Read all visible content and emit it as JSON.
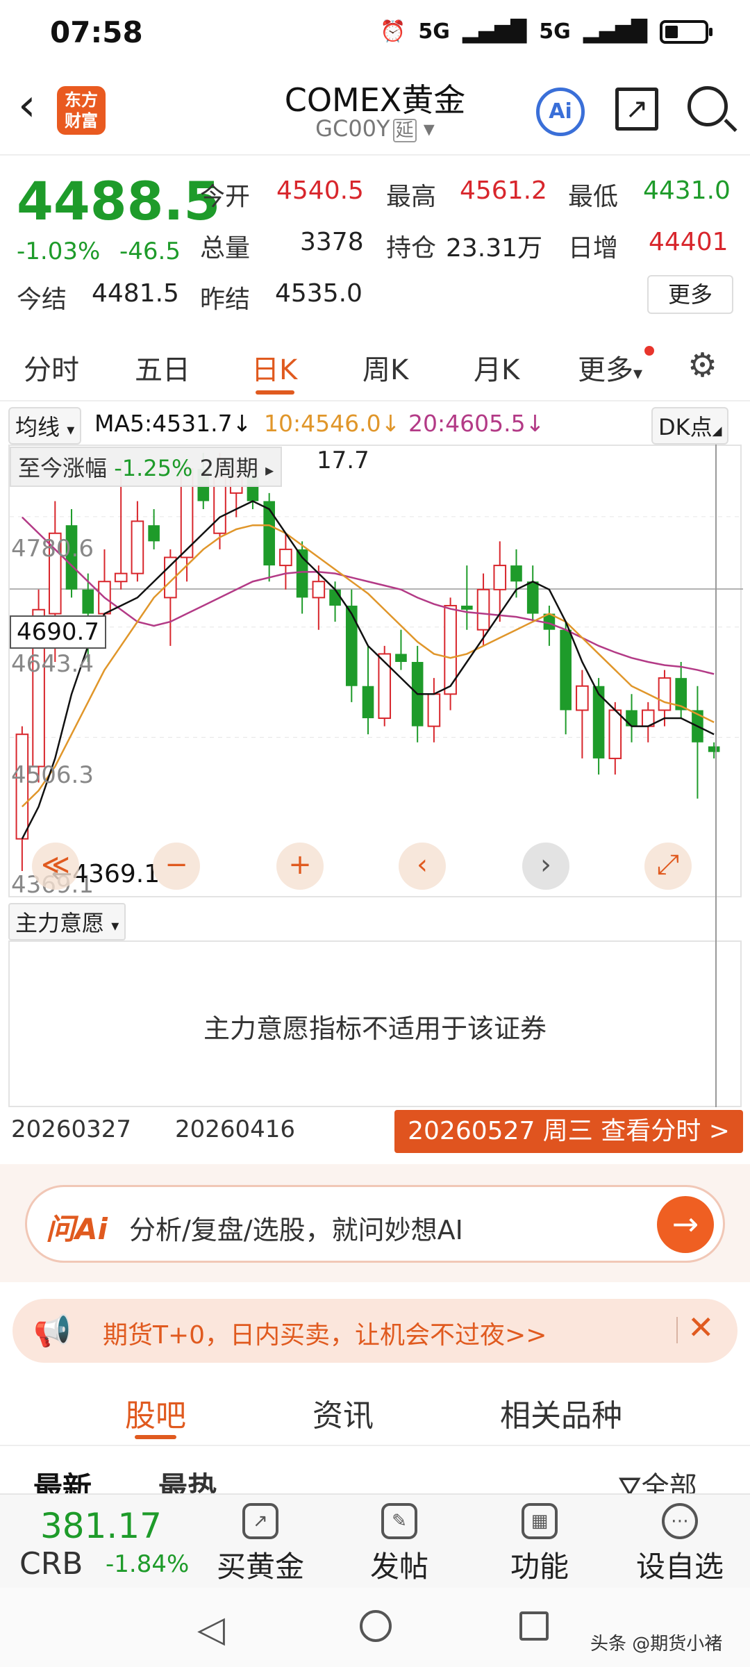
{
  "status": {
    "time": "07:58",
    "net1": "5G",
    "net2": "5G"
  },
  "header": {
    "title": "COMEX黄金",
    "subtitle": "GC00Y",
    "delay_tag": "延",
    "brand": "东方财富",
    "ai_label": "Ai"
  },
  "quote": {
    "price": "4488.5",
    "pct": "-1.03%",
    "change": "-46.5",
    "open_label": "今开",
    "open": "4540.5",
    "high_label": "最高",
    "high": "4561.2",
    "low_label": "最低",
    "low": "4431.0",
    "volume_label": "总量",
    "volume": "3378",
    "oi_label": "持仓",
    "oi": "23.31万",
    "daily_inc_label": "日增",
    "daily_inc": "44401",
    "settle_label": "今结",
    "settle": "4481.5",
    "prev_settle_label": "昨结",
    "prev_settle": "4535.0",
    "more_button": "更多"
  },
  "period_tabs": [
    "分时",
    "五日",
    "日K",
    "周K",
    "月K",
    "更多"
  ],
  "ma_bar": {
    "indicator": "均线",
    "ma5": "MA5:4531.7↓",
    "ma10": "10:4546.0↓",
    "ma20": "20:4605.5↓",
    "dk": "DK点",
    "colors": {
      "ma5": "#111111",
      "ma10": "#e0962a",
      "ma20": "#b33a86"
    }
  },
  "chart": {
    "range_label": "至今涨幅",
    "range_pct": "-1.25%",
    "range_period": "2周期",
    "top_value": "17.7",
    "price_labels": [
      "4780.6",
      "4643.4",
      "4506.3",
      "4369.1"
    ],
    "crosshair": "4690.7",
    "min_marker": "4369.1",
    "nav_buttons": [
      "≪",
      "−",
      "+",
      "‹",
      "›",
      "⤢"
    ]
  },
  "chart_data": {
    "type": "candlestick",
    "ylim": [
      4340,
      4860
    ],
    "up_color": "#d8262c",
    "down_color": "#1e9b2a",
    "candles": [
      {
        "o": 4380,
        "h": 4520,
        "l": 4340,
        "c": 4510
      },
      {
        "o": 4470,
        "h": 4690,
        "l": 4450,
        "c": 4665
      },
      {
        "o": 4660,
        "h": 4800,
        "l": 4600,
        "c": 4760
      },
      {
        "o": 4770,
        "h": 4790,
        "l": 4680,
        "c": 4690
      },
      {
        "o": 4690,
        "h": 4710,
        "l": 4600,
        "c": 4660
      },
      {
        "o": 4660,
        "h": 4740,
        "l": 4640,
        "c": 4700
      },
      {
        "o": 4700,
        "h": 4850,
        "l": 4690,
        "c": 4710
      },
      {
        "o": 4710,
        "h": 4800,
        "l": 4700,
        "c": 4775
      },
      {
        "o": 4770,
        "h": 4790,
        "l": 4740,
        "c": 4750
      },
      {
        "o": 4680,
        "h": 4740,
        "l": 4620,
        "c": 4730
      },
      {
        "o": 4730,
        "h": 4850,
        "l": 4700,
        "c": 4840
      },
      {
        "o": 4840,
        "h": 4860,
        "l": 4790,
        "c": 4800
      },
      {
        "o": 4760,
        "h": 4860,
        "l": 4740,
        "c": 4830
      },
      {
        "o": 4810,
        "h": 4850,
        "l": 4780,
        "c": 4830
      },
      {
        "o": 4830,
        "h": 4840,
        "l": 4790,
        "c": 4800
      },
      {
        "o": 4800,
        "h": 4810,
        "l": 4700,
        "c": 4720
      },
      {
        "o": 4720,
        "h": 4760,
        "l": 4690,
        "c": 4740
      },
      {
        "o": 4740,
        "h": 4750,
        "l": 4660,
        "c": 4680
      },
      {
        "o": 4680,
        "h": 4720,
        "l": 4640,
        "c": 4700
      },
      {
        "o": 4690,
        "h": 4700,
        "l": 4650,
        "c": 4670
      },
      {
        "o": 4670,
        "h": 4690,
        "l": 4550,
        "c": 4570
      },
      {
        "o": 4570,
        "h": 4620,
        "l": 4510,
        "c": 4530
      },
      {
        "o": 4530,
        "h": 4620,
        "l": 4520,
        "c": 4610
      },
      {
        "o": 4610,
        "h": 4640,
        "l": 4590,
        "c": 4600
      },
      {
        "o": 4600,
        "h": 4620,
        "l": 4500,
        "c": 4520
      },
      {
        "o": 4520,
        "h": 4580,
        "l": 4500,
        "c": 4560
      },
      {
        "o": 4560,
        "h": 4680,
        "l": 4540,
        "c": 4670
      },
      {
        "o": 4670,
        "h": 4720,
        "l": 4640,
        "c": 4665
      },
      {
        "o": 4640,
        "h": 4710,
        "l": 4620,
        "c": 4690
      },
      {
        "o": 4690,
        "h": 4750,
        "l": 4650,
        "c": 4720
      },
      {
        "o": 4720,
        "h": 4740,
        "l": 4680,
        "c": 4700
      },
      {
        "o": 4700,
        "h": 4720,
        "l": 4650,
        "c": 4660
      },
      {
        "o": 4660,
        "h": 4670,
        "l": 4620,
        "c": 4640
      },
      {
        "o": 4640,
        "h": 4650,
        "l": 4510,
        "c": 4540
      },
      {
        "o": 4540,
        "h": 4590,
        "l": 4480,
        "c": 4570
      },
      {
        "o": 4570,
        "h": 4580,
        "l": 4460,
        "c": 4480
      },
      {
        "o": 4480,
        "h": 4550,
        "l": 4460,
        "c": 4540
      },
      {
        "o": 4540,
        "h": 4560,
        "l": 4500,
        "c": 4520
      },
      {
        "o": 4520,
        "h": 4550,
        "l": 4500,
        "c": 4540
      },
      {
        "o": 4540,
        "h": 4590,
        "l": 4520,
        "c": 4580
      },
      {
        "o": 4580,
        "h": 4600,
        "l": 4530,
        "c": 4540
      },
      {
        "o": 4540,
        "h": 4570,
        "l": 4430,
        "c": 4500
      },
      {
        "o": 4495,
        "h": 4500,
        "l": 4480,
        "c": 4488
      }
    ],
    "ma5": [
      4380,
      4420,
      4480,
      4560,
      4620,
      4660,
      4670,
      4680,
      4700,
      4720,
      4740,
      4760,
      4780,
      4790,
      4800,
      4790,
      4760,
      4730,
      4710,
      4690,
      4660,
      4620,
      4600,
      4580,
      4560,
      4560,
      4570,
      4600,
      4630,
      4660,
      4690,
      4700,
      4690,
      4650,
      4600,
      4560,
      4540,
      4520,
      4520,
      4530,
      4530,
      4520,
      4510
    ],
    "ma10": [
      4420,
      4440,
      4470,
      4510,
      4550,
      4590,
      4620,
      4650,
      4680,
      4700,
      4720,
      4740,
      4755,
      4765,
      4770,
      4770,
      4760,
      4745,
      4730,
      4715,
      4700,
      4685,
      4665,
      4645,
      4625,
      4610,
      4605,
      4610,
      4620,
      4630,
      4640,
      4650,
      4660,
      4650,
      4630,
      4610,
      4590,
      4570,
      4560,
      4550,
      4545,
      4535,
      4525
    ],
    "ma20": [
      4780,
      4760,
      4740,
      4720,
      4700,
      4680,
      4665,
      4650,
      4645,
      4650,
      4660,
      4670,
      4680,
      4690,
      4700,
      4705,
      4710,
      4712,
      4712,
      4710,
      4705,
      4700,
      4695,
      4690,
      4680,
      4672,
      4666,
      4662,
      4660,
      4658,
      4656,
      4652,
      4648,
      4640,
      4630,
      4620,
      4612,
      4605,
      4600,
      4596,
      4594,
      4590,
      4585
    ]
  },
  "sub_indicator": {
    "label": "主力意愿",
    "message": "主力意愿指标不适用于该证券"
  },
  "dates": {
    "left": "20260327",
    "mid": "20260416",
    "tip": "20260527 周三 查看分时 >"
  },
  "ai_bar": {
    "brand": "问Ai",
    "placeholder": "分析/复盘/选股，就问妙想AI"
  },
  "promo": {
    "text": "期货T+0，日内买卖，让机会不过夜>>"
  },
  "content_tabs": [
    "股吧",
    "资讯",
    "相关品种"
  ],
  "sort_row": {
    "latest": "最新",
    "hot": "最热",
    "filter": "全部"
  },
  "bottom_bar": {
    "crb_value": "381.17",
    "crb_name": "CRB",
    "crb_pct": "-1.84%",
    "items": [
      "买黄金",
      "发帖",
      "功能",
      "设自选"
    ]
  },
  "watermark": "头条 @期货小褚"
}
